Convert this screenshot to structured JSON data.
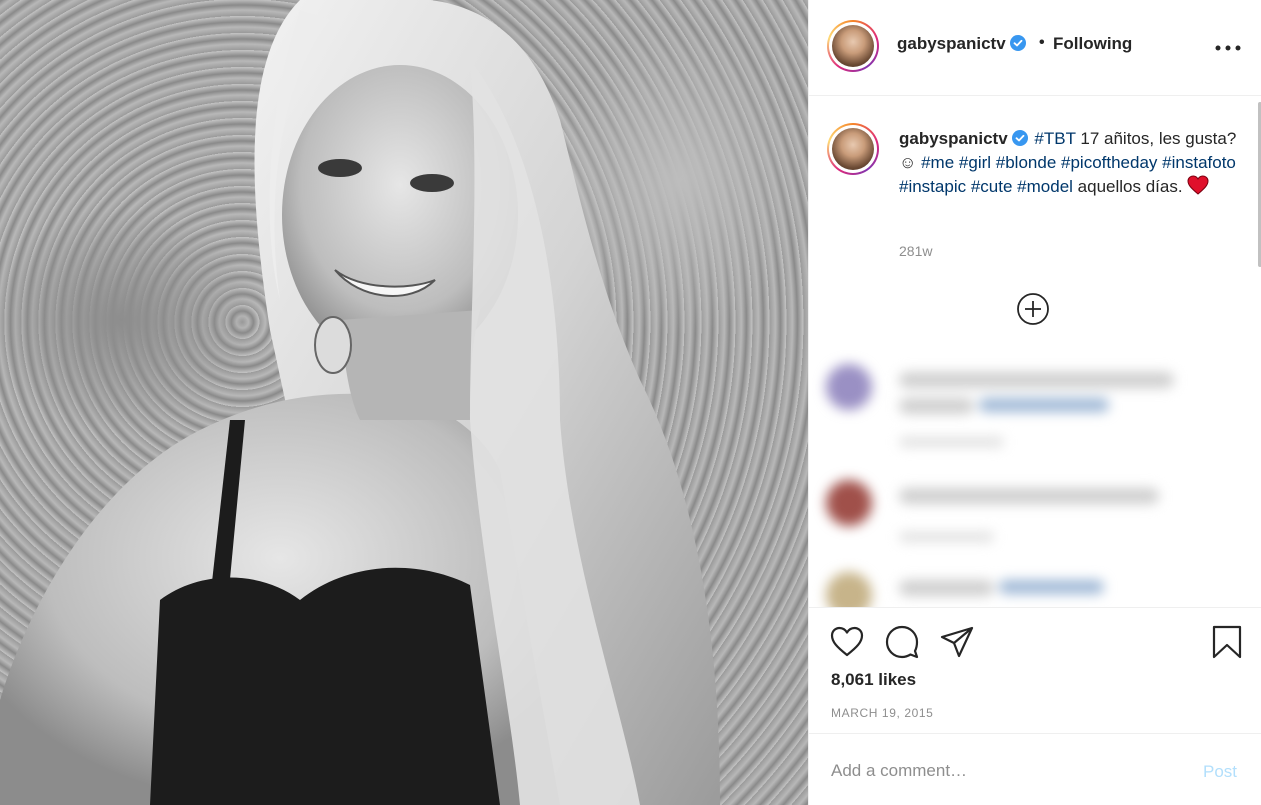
{
  "photo": {
    "icon": "black-and-white-portrait-photo"
  },
  "header": {
    "username": "gabyspanictv",
    "verified_icon": "verified-badge-icon",
    "separator": "•",
    "follow_status": "Following",
    "more_icon": "more-options-icon"
  },
  "caption": {
    "username": "gabyspanictv",
    "segments": [
      {
        "type": "tag",
        "text": "#TBT"
      },
      {
        "type": "text",
        "text": " 17 añitos, les gusta? ☺ "
      },
      {
        "type": "tag",
        "text": "#me"
      },
      {
        "type": "text",
        "text": " "
      },
      {
        "type": "tag",
        "text": "#girl"
      },
      {
        "type": "text",
        "text": " "
      },
      {
        "type": "tag",
        "text": "#blonde"
      },
      {
        "type": "text",
        "text": " "
      },
      {
        "type": "tag",
        "text": "#picoftheday"
      },
      {
        "type": "text",
        "text": " "
      },
      {
        "type": "tag",
        "text": "#instafoto"
      },
      {
        "type": "text",
        "text": " "
      },
      {
        "type": "tag",
        "text": "#instapic"
      },
      {
        "type": "text",
        "text": " "
      },
      {
        "type": "tag",
        "text": "#cute"
      },
      {
        "type": "text",
        "text": " "
      },
      {
        "type": "tag",
        "text": "#model"
      },
      {
        "type": "text",
        "text": " aquellos días. "
      }
    ],
    "age": "281w",
    "load_more_icon": "plus-circle-icon"
  },
  "actions": {
    "like_icon": "heart-icon",
    "comment_icon": "comment-icon",
    "share_icon": "share-icon",
    "save_icon": "bookmark-icon",
    "likes": "8,061 likes",
    "date": "MARCH 19, 2015"
  },
  "comment_box": {
    "placeholder": "Add a comment…",
    "post_label": "Post"
  },
  "colors": {
    "link_tag": "#00376b",
    "muted": "#8e8e8e",
    "post_disabled": "#b2dffc",
    "verified": "#3897f0",
    "heart_red": "#e0102b"
  }
}
